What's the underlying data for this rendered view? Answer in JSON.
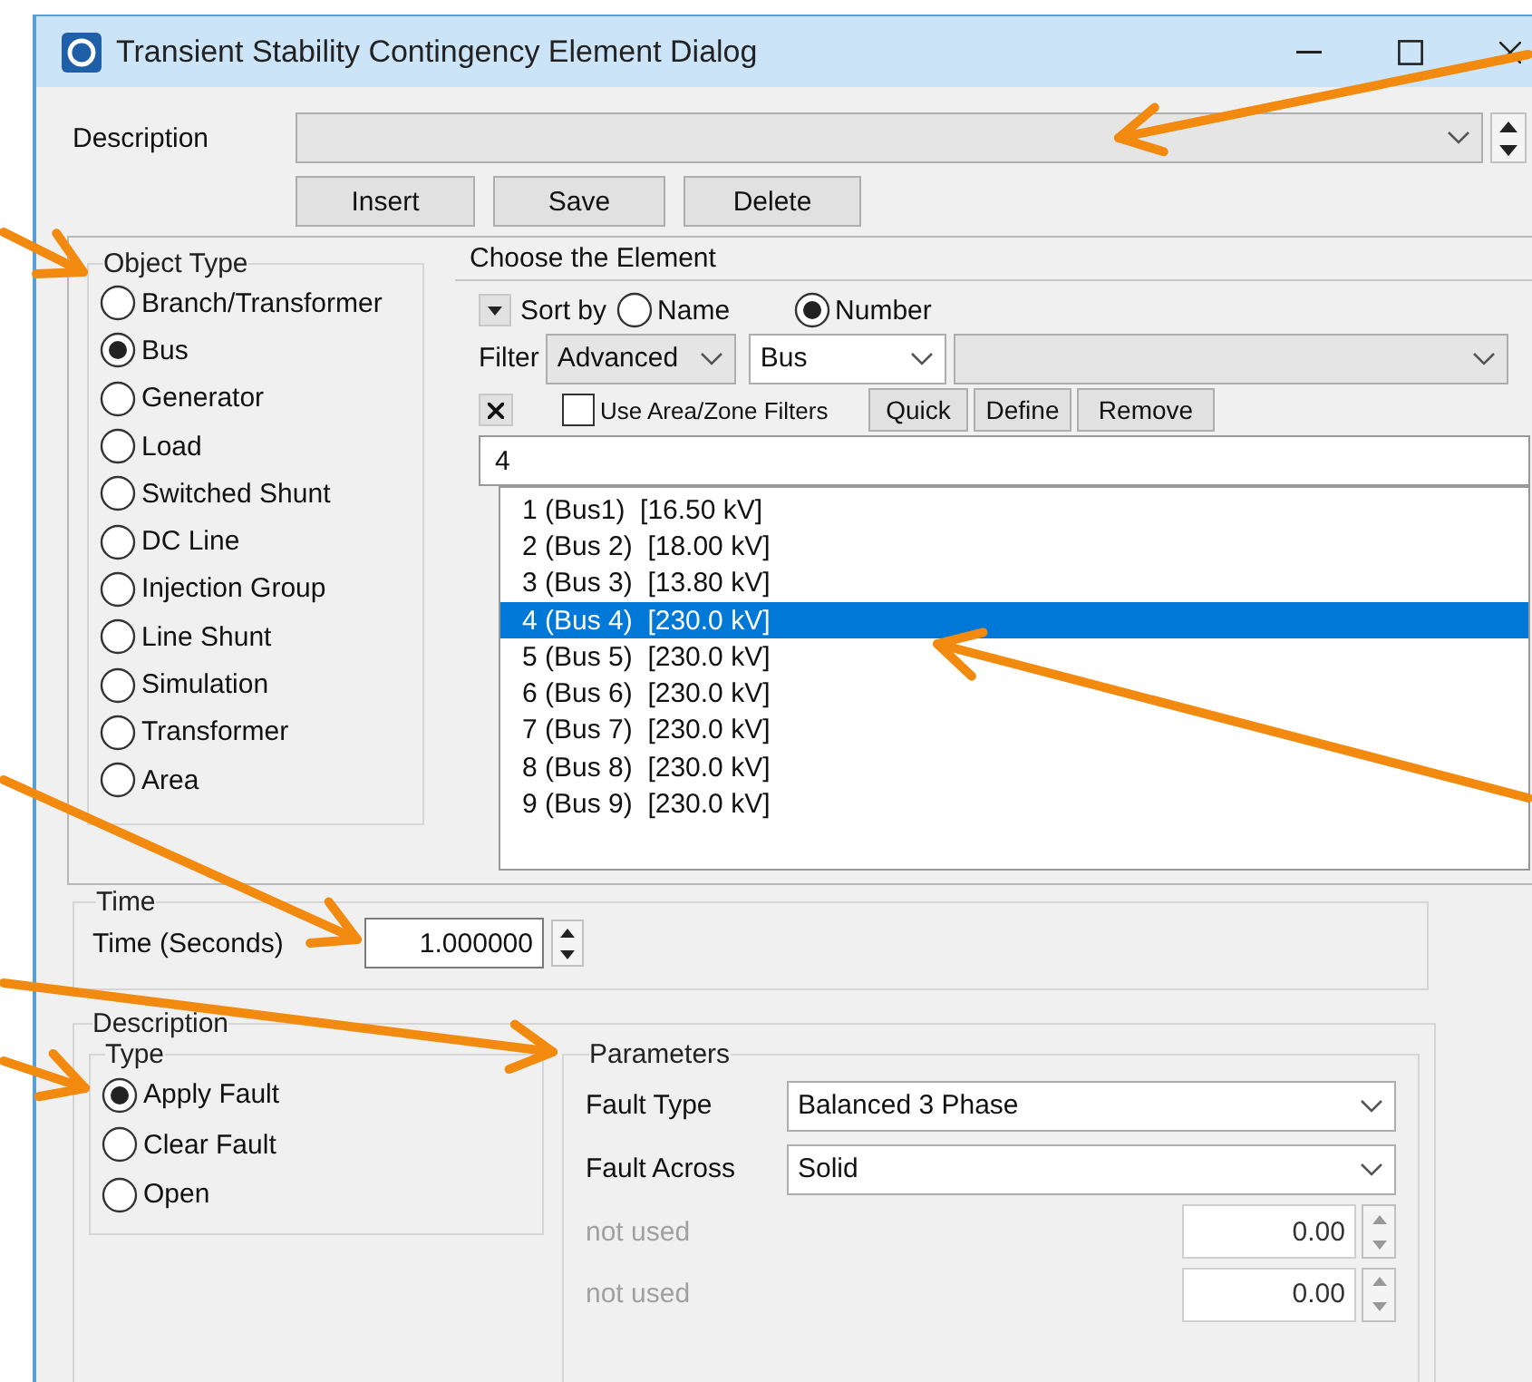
{
  "window": {
    "title": "Transient Stability Contingency Element Dialog"
  },
  "description": {
    "label": "Description"
  },
  "buttons": [
    "Insert",
    "Save",
    "Delete"
  ],
  "object_type": {
    "title": "Object Type",
    "options": [
      {
        "label": "Branch/Transformer",
        "selected": false
      },
      {
        "label": "Bus",
        "selected": true
      },
      {
        "label": "Generator",
        "selected": false
      },
      {
        "label": "Load",
        "selected": false
      },
      {
        "label": "Switched Shunt",
        "selected": false
      },
      {
        "label": "DC Line",
        "selected": false
      },
      {
        "label": "Injection Group",
        "selected": false
      },
      {
        "label": "Line Shunt",
        "selected": false
      },
      {
        "label": "Simulation",
        "selected": false
      },
      {
        "label": "Transformer",
        "selected": false
      },
      {
        "label": "Area",
        "selected": false
      }
    ]
  },
  "choose_element": {
    "title": "Choose the Element",
    "sort_label": "Sort by",
    "sort_options": [
      {
        "label": "Name",
        "selected": false
      },
      {
        "label": "Number",
        "selected": true
      }
    ],
    "filter_label": "Filter",
    "filter_mode": "Advanced",
    "filter_object": "Bus",
    "use_area_zone": {
      "label": "Use Area/Zone Filters",
      "checked": false
    },
    "filter_buttons": [
      "Quick",
      "Define",
      "Remove"
    ],
    "search": "4",
    "elements": [
      {
        "label": "1 (Bus1)  [16.50 kV]",
        "selected": false
      },
      {
        "label": "2 (Bus 2)  [18.00 kV]",
        "selected": false
      },
      {
        "label": "3 (Bus 3)  [13.80 kV]",
        "selected": false
      },
      {
        "label": "4 (Bus 4)  [230.0 kV]",
        "selected": true
      },
      {
        "label": "5 (Bus 5)  [230.0 kV]",
        "selected": false
      },
      {
        "label": "6 (Bus 6)  [230.0 kV]",
        "selected": false
      },
      {
        "label": "7 (Bus 7)  [230.0 kV]",
        "selected": false
      },
      {
        "label": "8 (Bus 8)  [230.0 kV]",
        "selected": false
      },
      {
        "label": "9 (Bus 9)  [230.0 kV]",
        "selected": false
      }
    ]
  },
  "time": {
    "title": "Time",
    "label": "Time (Seconds)",
    "value": "1.000000"
  },
  "description_group": {
    "title": "Description",
    "type": {
      "title": "Type",
      "options": [
        {
          "label": "Apply Fault",
          "selected": true
        },
        {
          "label": "Clear Fault",
          "selected": false
        },
        {
          "label": "Open",
          "selected": false
        }
      ]
    },
    "parameters": {
      "title": "Parameters",
      "rows": [
        {
          "kind": "select",
          "label": "Fault Type",
          "value": "Balanced 3 Phase",
          "disabled": false
        },
        {
          "kind": "select",
          "label": "Fault Across",
          "value": "Solid",
          "disabled": false
        },
        {
          "kind": "number",
          "label": "not used",
          "value": "0.00",
          "disabled": true
        },
        {
          "kind": "number",
          "label": "not used",
          "value": "0.00",
          "disabled": true
        }
      ]
    }
  }
}
